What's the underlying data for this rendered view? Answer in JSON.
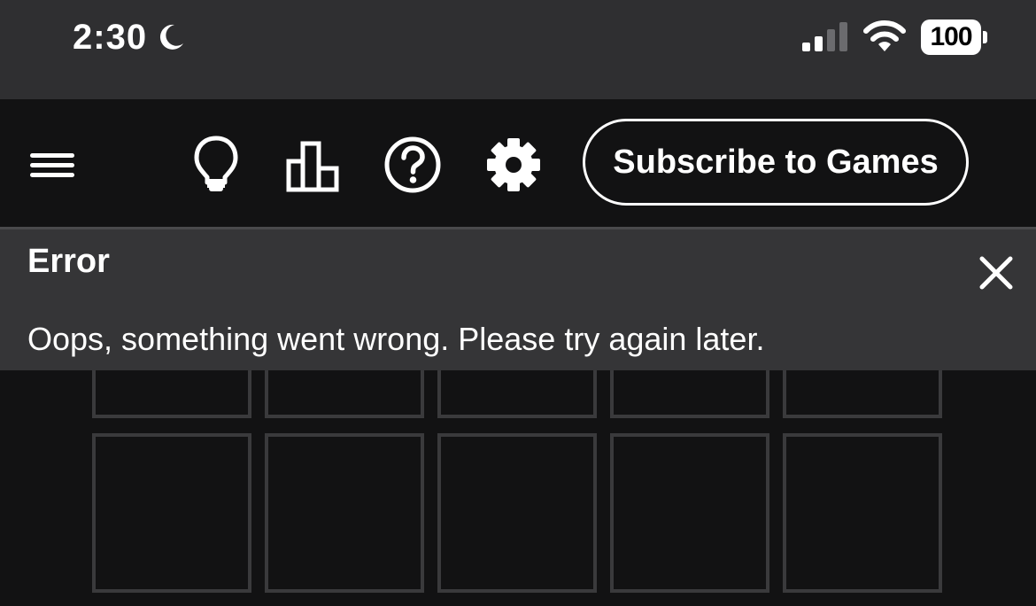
{
  "status_bar": {
    "time": "2:30",
    "battery_level": "100",
    "icons": [
      "moon-icon",
      "signal-icon",
      "wifi-icon",
      "battery-icon"
    ]
  },
  "toolbar": {
    "icons": [
      "menu-icon",
      "lightbulb-icon",
      "stats-icon",
      "help-icon",
      "gear-icon"
    ],
    "subscribe_label": "Subscribe to Games"
  },
  "error": {
    "title": "Error",
    "message": "Oops, something went wrong. Please try again later.",
    "close_icon": "close-icon"
  },
  "board": {
    "columns": 5,
    "visible_rows": 2,
    "tile_border_color": "#3a3a3c"
  },
  "colors": {
    "background": "#121213",
    "status_bar": "#2f2f31",
    "banner": "#353537",
    "text": "#ffffff"
  }
}
